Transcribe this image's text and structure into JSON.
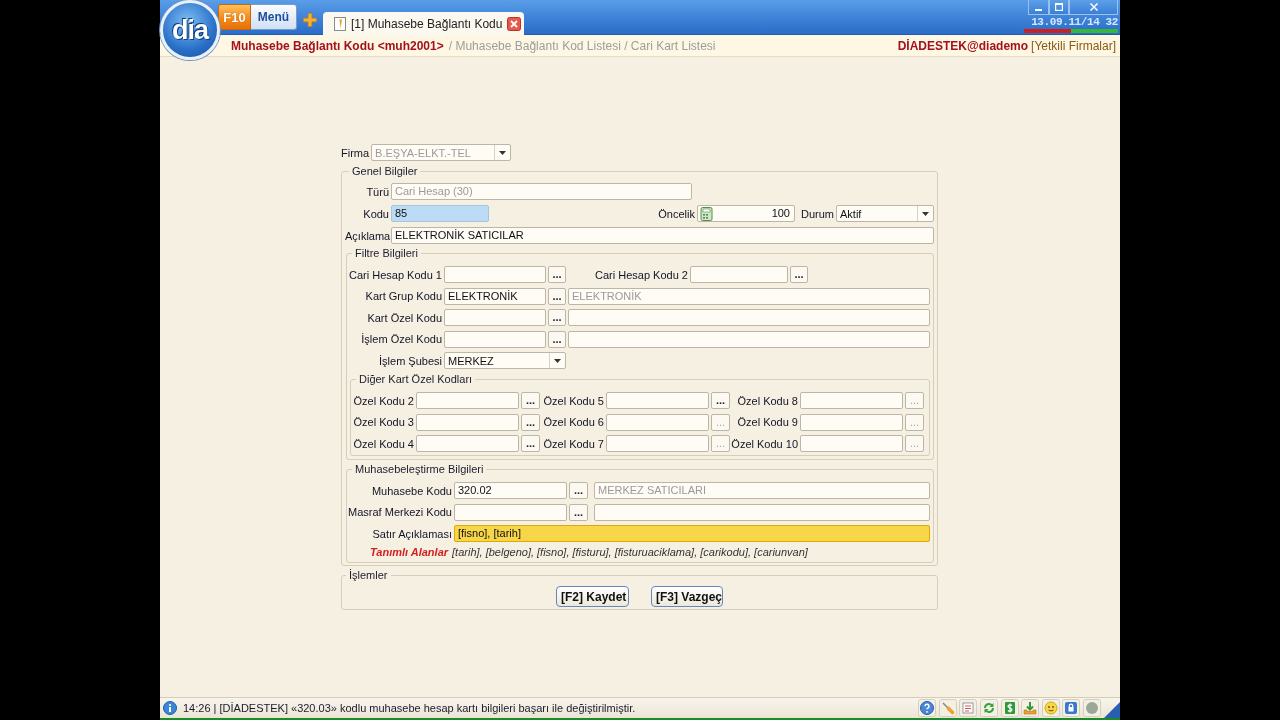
{
  "header": {
    "logo": "dia",
    "menu_key": "F10",
    "menu_label": "Menü",
    "tabs": [
      {
        "label": "[1] Muhasebe Bağlantı Kodu",
        "selected": true
      }
    ],
    "clock": "13.09.11/14 32"
  },
  "breadcrumb": {
    "current": "Muhasebe Bağlantı Kodu <muh2001>",
    "trail": "/ Muhasebe Bağlantı Kod Listesi / Cari Kart Listesi",
    "user": "DİADESTEK@diademo",
    "user_link": "[Yetkili Firmalar]"
  },
  "form": {
    "firma": {
      "label": "Firma",
      "value": "B.EŞYA-ELKT.-TEL",
      "disabled": true
    },
    "genel": {
      "title": "Genel Bilgiler",
      "turu": {
        "label": "Türü",
        "value": "Cari Hesap (30)",
        "disabled": true
      },
      "kodu": {
        "label": "Kodu",
        "value": "85",
        "highlighted": true
      },
      "oncelik": {
        "label": "Öncelik",
        "value": "100"
      },
      "durum": {
        "label": "Durum",
        "value": "Aktif"
      },
      "aciklama": {
        "label": "Açıklama",
        "value": "ELEKTRONİK SATICILAR"
      },
      "filtre": {
        "title": "Filtre Bilgileri",
        "cari_hesap": [
          {
            "label": "Cari Hesap Kodu 1",
            "button": "..."
          },
          {
            "label": "Cari Hesap Kodu 2",
            "button": "..."
          }
        ],
        "lookups": [
          {
            "label": "Kart Grup Kodu",
            "value": "ELEKTRONİK",
            "button": "...",
            "description": "ELEKTRONİK"
          },
          {
            "label": "Kart Özel Kodu",
            "button": "..."
          },
          {
            "label": "İşlem Özel Kodu",
            "button": "..."
          }
        ],
        "sube": {
          "label": "İşlem Şubesi",
          "value": "MERKEZ"
        },
        "diger": {
          "title": "Diğer Kart Özel Kodları",
          "codes": [
            {
              "label": "Özel Kodu 2",
              "button": "...",
              "disabled": false
            },
            {
              "label": "Özel Kodu 5",
              "button": "...",
              "disabled": false
            },
            {
              "label": "Özel Kodu 8",
              "button": "...",
              "disabled": true
            },
            {
              "label": "Özel Kodu 3",
              "button": "...",
              "disabled": false
            },
            {
              "label": "Özel Kodu 6",
              "button": "...",
              "disabled": true
            },
            {
              "label": "Özel Kodu 9",
              "button": "...",
              "disabled": true
            },
            {
              "label": "Özel Kodu 4",
              "button": "...",
              "disabled": false
            },
            {
              "label": "Özel Kodu 7",
              "button": "...",
              "disabled": true
            },
            {
              "label": "Özel Kodu 10",
              "button": "...",
              "disabled": true
            }
          ]
        }
      },
      "muhasebe": {
        "title": "Muhasebeleştirme Bilgileri",
        "lookups": [
          {
            "label": "Muhasebe Kodu",
            "value": "320.02",
            "button": "...",
            "description": "MERKEZ SATICILARI"
          },
          {
            "label": "Masraf Merkezi Kodu",
            "button": "..."
          }
        ],
        "satir": {
          "label": "Satır Açıklaması",
          "value": "[fisno], [tarih]",
          "focused": true
        },
        "defined": {
          "label": "Tanımlı Alanlar",
          "fields": "[tarih], [belgeno], [fisno], [fisturu], [fisturuaciklama], [carikodu], [cariunvan]"
        }
      }
    }
  },
  "actions": {
    "title": "İşlemler",
    "buttons": [
      "[F2] Kaydet",
      "[F3] Vazgeç"
    ]
  },
  "status_bar": {
    "message": "14:26 | [DİADESTEK] «320.03» kodlu muhasebe hesap kartı bilgileri başarı ile değiştirilmiştir."
  }
}
